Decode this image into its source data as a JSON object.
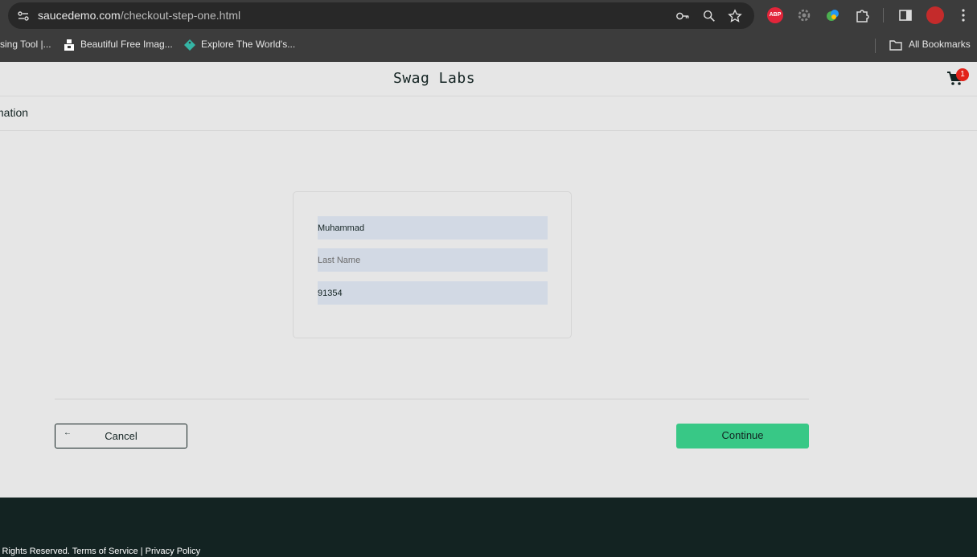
{
  "browser": {
    "url_host": "saucedemo.com",
    "url_path": "/checkout-step-one.html",
    "icons": [
      "site-info-icon",
      "key-icon",
      "zoom-icon",
      "star-icon",
      "adblock-icon",
      "settings-extension-icon",
      "color-extension-icon",
      "puzzle-icon",
      "sidepanel-icon",
      "avatar",
      "kebab-menu-icon"
    ],
    "adblock_label": "ABP",
    "bookmarks": [
      {
        "label": "sing Tool |..."
      },
      {
        "label": "Beautiful Free Imag..."
      },
      {
        "label": "Explore The World's..."
      }
    ],
    "all_bookmarks": "All Bookmarks"
  },
  "app": {
    "logo": "Swag Labs",
    "cart_count": "1",
    "page_title": "mation"
  },
  "form": {
    "first_name_value": "Muhammad",
    "last_name_placeholder": "Last Name",
    "postal_code_value": "91354"
  },
  "actions": {
    "cancel_icon": "←",
    "cancel_label": "Cancel",
    "continue_label": "Continue"
  },
  "footer": {
    "text": "l Rights Reserved. Terms of Service | Privacy Policy"
  },
  "colors": {
    "accent": "#38c886",
    "footer_bg": "#132322",
    "field_bg": "#d2d9e4",
    "badge": "#e2231a"
  }
}
